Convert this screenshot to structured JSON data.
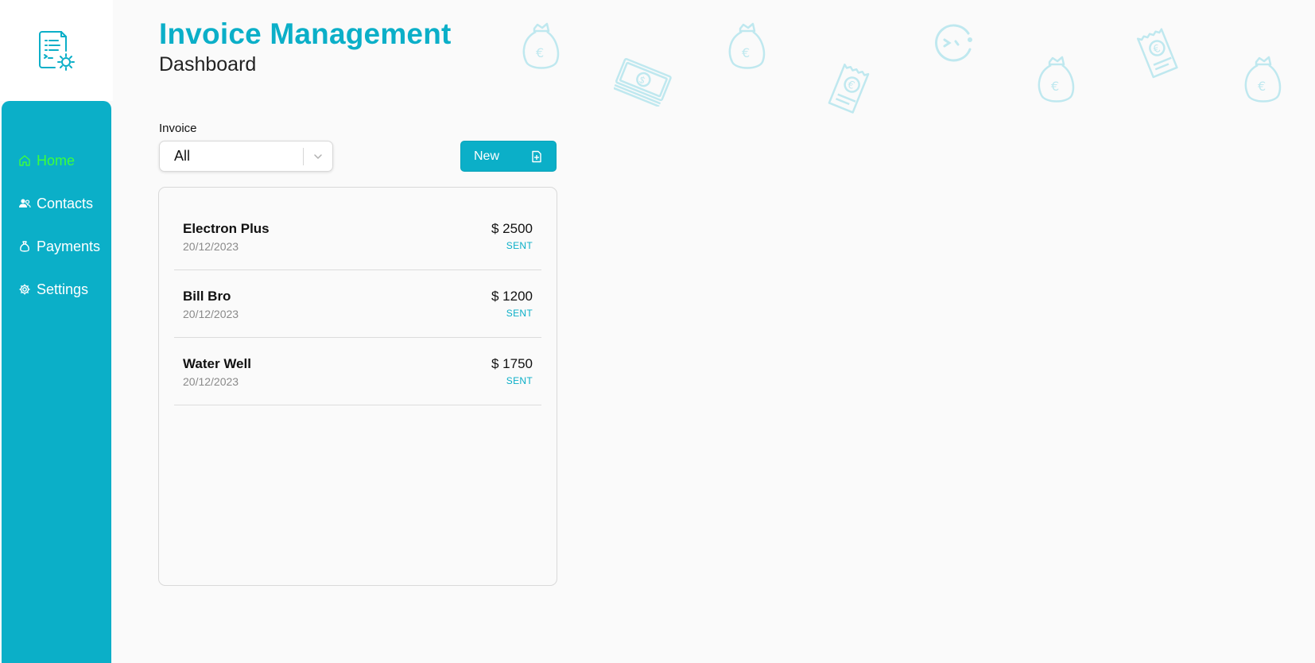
{
  "header": {
    "title": "Invoice Management",
    "subtitle": "Dashboard"
  },
  "sidebar": {
    "items": [
      {
        "label": "Home",
        "icon": "home-icon",
        "active": true
      },
      {
        "label": "Contacts",
        "icon": "contacts-icon",
        "active": false
      },
      {
        "label": "Payments",
        "icon": "money-bag-icon",
        "active": false
      },
      {
        "label": "Settings",
        "icon": "gear-icon",
        "active": false
      }
    ]
  },
  "filter": {
    "label": "Invoice",
    "selected": "All"
  },
  "actions": {
    "new_label": "New"
  },
  "invoices": [
    {
      "name": "Electron Plus",
      "date": "20/12/2023",
      "amount": "$ 2500",
      "status": "SENT"
    },
    {
      "name": "Bill Bro",
      "date": "20/12/2023",
      "amount": "$ 1200",
      "status": "SENT"
    },
    {
      "name": "Water Well",
      "date": "20/12/2023",
      "amount": "$ 1750",
      "status": "SENT"
    }
  ],
  "colors": {
    "accent": "#0bafc8",
    "active_nav": "#3cff3c",
    "background": "#fafafa",
    "decoration": "#bfe8ef"
  }
}
